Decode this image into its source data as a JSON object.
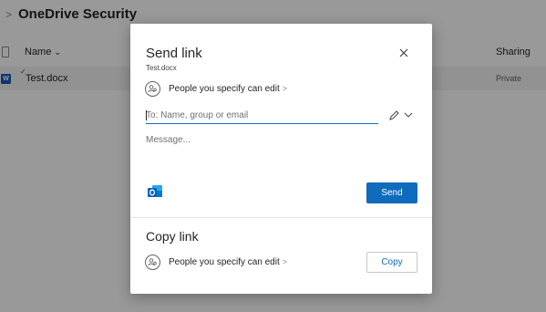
{
  "app": {
    "breadcrumb_separator": ">",
    "title": "OneDrive Security"
  },
  "list": {
    "columns": {
      "name": "Name",
      "name_sort_icon": "chevron-down-icon",
      "sharing": "Sharing"
    },
    "rows": [
      {
        "file_type_icon": "word-document-icon",
        "name": "Test.docx",
        "sharing": "Private"
      }
    ]
  },
  "dialog": {
    "title": "Send link",
    "subtitle": "Test.docx",
    "close_icon": "close-icon",
    "permission_label": "People you specify can edit",
    "permission_chevron": ">",
    "to_placeholder": "To: Name, group or email",
    "message_placeholder": "Message...",
    "send_label": "Send",
    "copy_title": "Copy link",
    "copy_permission_label": "People you specify can edit",
    "copy_label": "Copy"
  },
  "colors": {
    "accent": "#0f6cbd",
    "overlay": "rgba(0,0,0,0.40)",
    "word_blue": "#185abd"
  }
}
